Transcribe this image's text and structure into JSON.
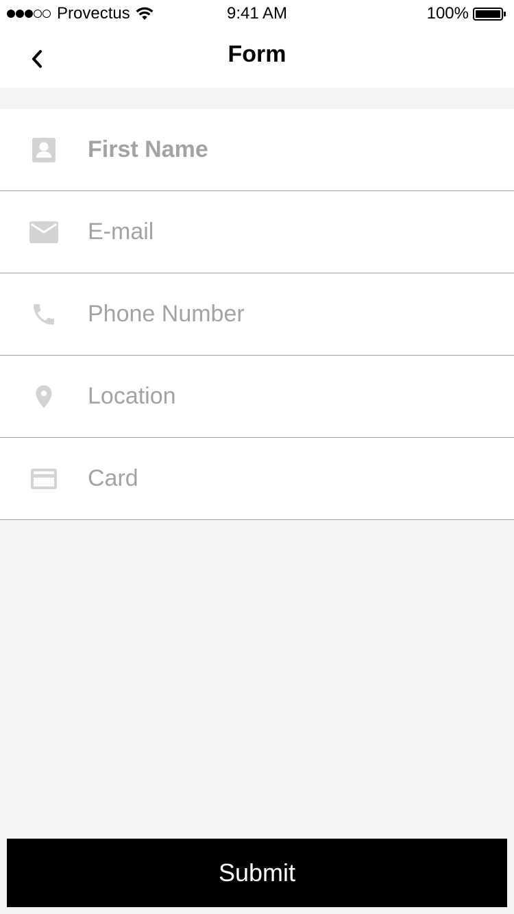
{
  "status_bar": {
    "carrier": "Provectus",
    "time": "9:41 AM",
    "battery": "100%",
    "signal_filled": 3,
    "signal_empty": 2,
    "wifi_icon": "wifi-icon",
    "battery_level": 1.0
  },
  "nav": {
    "title": "Form",
    "back_icon": "chevron-left-icon"
  },
  "form": {
    "fields": [
      {
        "placeholder": "First Name",
        "value": "",
        "icon": "person-icon"
      },
      {
        "placeholder": "E-mail",
        "value": "",
        "icon": "mail-icon"
      },
      {
        "placeholder": "Phone Number",
        "value": "",
        "icon": "phone-icon"
      },
      {
        "placeholder": "Location",
        "value": "",
        "icon": "location-pin-icon"
      },
      {
        "placeholder": "Card",
        "value": "",
        "icon": "credit-card-icon"
      }
    ]
  },
  "submit": {
    "label": "Submit"
  },
  "colors": {
    "background": "#f4f4f4",
    "surface": "#ffffff",
    "icon": "#d3d3d3",
    "placeholder": "#a3a3a3",
    "divider": "#9e9e9e",
    "button": "#000000",
    "button_text": "#ffffff"
  }
}
